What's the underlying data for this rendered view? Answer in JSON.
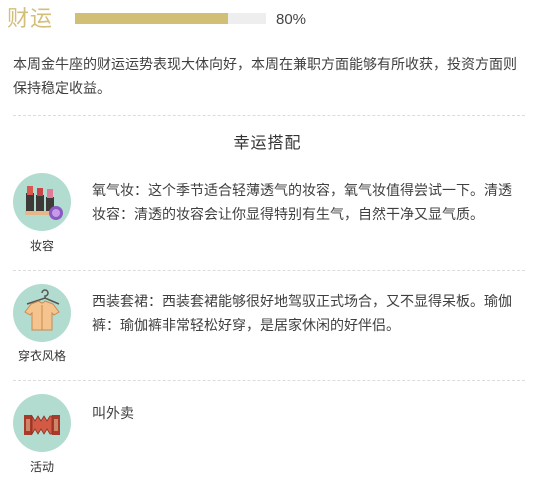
{
  "fortune": {
    "title": "财运",
    "progress": 0.8,
    "progress_label": "80%",
    "accent_color": "#d1bf75",
    "description": "本周金牛座的财运运势表现大体向好，本周在兼职方面能够有所收获，投资方面则保持稳定收益。"
  },
  "lucky": {
    "title": "幸运搭配",
    "icon_bg_color": "#b3dcd1",
    "items": [
      {
        "icon": "lipstick-icon",
        "label": "妆容",
        "text": "氧气妆：这个季节适合轻薄透气的妆容，氧气妆值得尝试一下。清透妆容：清透的妆容会让你显得特别有生气，自然干净又显气质。"
      },
      {
        "icon": "shirt-icon",
        "label": "穿衣风格",
        "text": "西装套裙：西装套裙能够很好地驾驭正式场合，又不显得呆板。瑜伽裤：瑜伽裤非常轻松好穿，是居家休闲的好伴侣。"
      },
      {
        "icon": "accordion-icon",
        "label": "活动",
        "text": "叫外卖"
      }
    ]
  }
}
